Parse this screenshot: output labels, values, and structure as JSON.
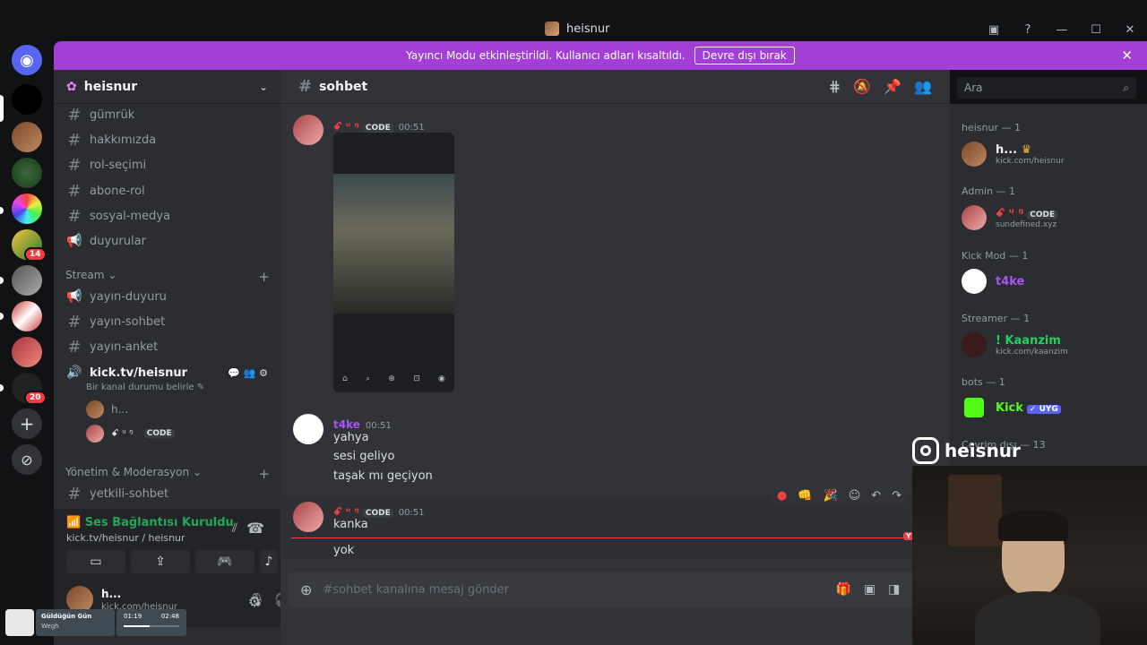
{
  "window": {
    "title": "heisnur",
    "controls": [
      "inbox-icon",
      "help-icon",
      "minimize-icon",
      "maximize-icon",
      "close-icon"
    ]
  },
  "banner": {
    "text": "Yayıncı Modu etkinleştirildi. Kullanıcı adları kısaltıldı.",
    "button": "Devre dışı bırak",
    "accent": "#a23fd6"
  },
  "servers": {
    "badges": [
      "14",
      "20"
    ]
  },
  "guild": {
    "name": "heisnur"
  },
  "channels": [
    {
      "name": "gümrük",
      "icon": "hash-icon"
    },
    {
      "name": "hakkımızda",
      "icon": "hash-icon"
    },
    {
      "name": "rol-seçimi",
      "icon": "hash-icon"
    },
    {
      "name": "abone-rol",
      "icon": "hash-icon"
    },
    {
      "name": "sosyal-medya",
      "icon": "hash-icon"
    },
    {
      "name": "duyurular",
      "icon": "megaphone-icon"
    }
  ],
  "stream_category": {
    "name": "Stream",
    "channels": [
      {
        "name": "yayın-duyuru",
        "icon": "megaphone-icon"
      },
      {
        "name": "yayın-sohbet",
        "icon": "hash-icon"
      },
      {
        "name": "yayın-anket",
        "icon": "hash-icon"
      }
    ],
    "voice_channel": {
      "name": "kick.tv/heisnur",
      "status": "Bir kanal durumu belirle",
      "users": [
        {
          "name": "h..."
        },
        {
          "name": "ꗃ ᵘ ᵑ",
          "tag": "CODE"
        }
      ]
    }
  },
  "mod_category": {
    "name": "Yönetim & Moderasyon",
    "channels": [
      {
        "name": "yetkili-sohbet",
        "icon": "hash-icon"
      }
    ]
  },
  "voice_panel": {
    "title": "Ses Bağlantısı Kuruldu",
    "subtitle": "kick.tv/heisnur / heisnur"
  },
  "user_panel": {
    "name": "h...",
    "status": "kick.com/heisnur"
  },
  "chat": {
    "channel": "sohbet",
    "composer_placeholder": "#sohbet kanalına mesaj gönder",
    "messages": [
      {
        "author": "ꗃ ᵘ ᵑ",
        "tag": "CODE",
        "time": "00:51",
        "lines": []
      },
      {
        "author": "t4ke",
        "time": "00:51",
        "lines": [
          "yahya",
          "sesi geliyo",
          "taşak mı geçiyon"
        ]
      },
      {
        "author": "ꗃ ᵘ ᵑ",
        "tag": "CODE",
        "time": "00:51",
        "lines": [
          "kanka",
          "yok"
        ]
      }
    ],
    "new_marker": "Y"
  },
  "search": {
    "placeholder": "Ara"
  },
  "members": {
    "groups": [
      {
        "title": "heisnur — 1",
        "members": [
          {
            "name": "h...",
            "status": "kick.com/heisnur",
            "color": "#f2f3f5"
          }
        ]
      },
      {
        "title": "Admin — 1",
        "members": [
          {
            "name": "ꗃ ᵘ ᵑ",
            "tag": "CODE",
            "status": "sundefined.xyz",
            "color": "#f23f43"
          }
        ]
      },
      {
        "title": "Kick Mod — 1",
        "members": [
          {
            "name": "t4ke",
            "color": "#a855f7"
          }
        ]
      },
      {
        "title": "Streamer — 1",
        "members": [
          {
            "name": "! Kaanzim",
            "status": "kick.com/kaanzim",
            "color": "#23d160"
          }
        ]
      },
      {
        "title": "bots — 1",
        "members": [
          {
            "name": "Kick",
            "tag": "✓ UYG",
            "color": "#53fc18"
          }
        ]
      },
      {
        "title": "Çevrim dışı — 13",
        "members": []
      }
    ]
  },
  "overlay": {
    "instagram": "heisnur"
  },
  "now_playing": {
    "title": "Güldüğün Gün",
    "artist": "Wegh",
    "elapsed": "01:19",
    "total": "02:48"
  }
}
